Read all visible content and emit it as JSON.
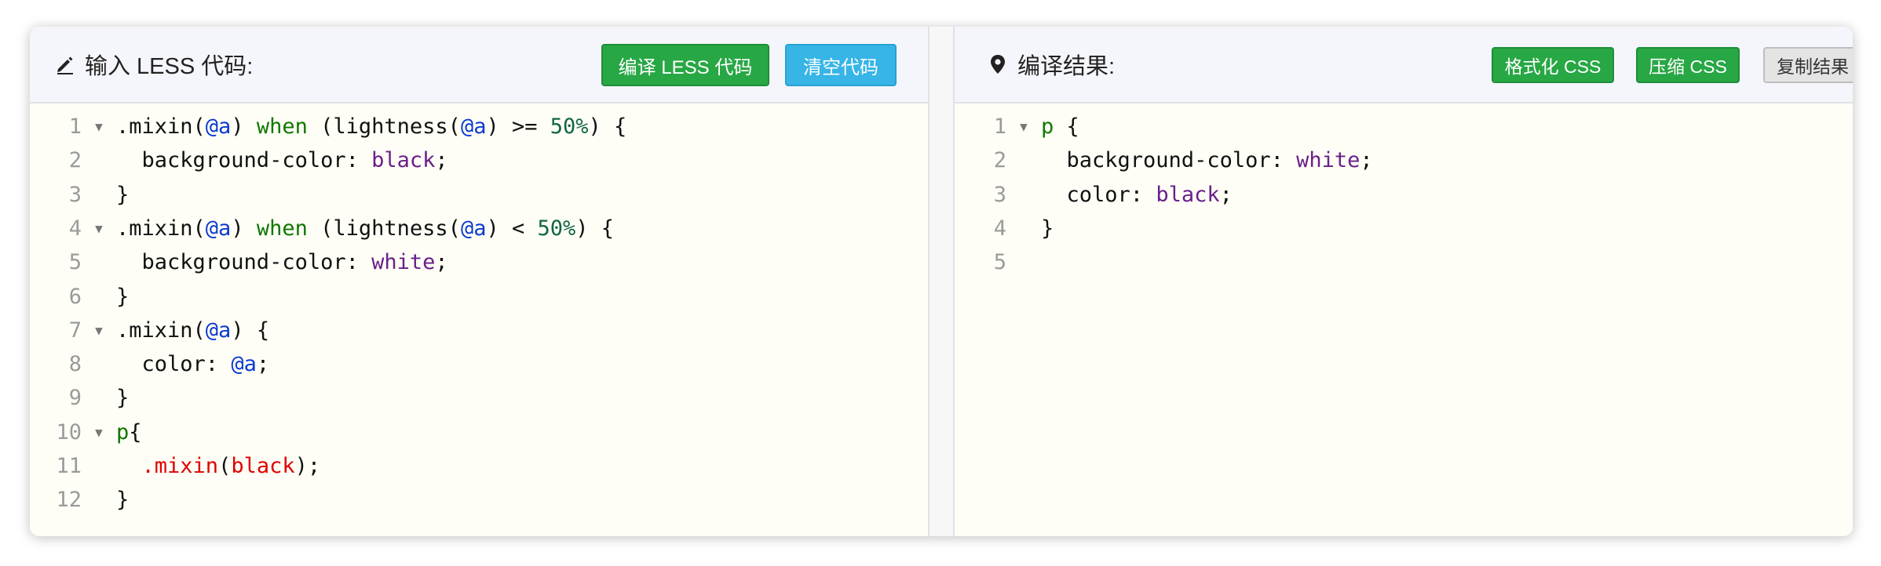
{
  "left": {
    "title": "输入 LESS 代码:",
    "title_icon": "pencil-icon",
    "buttons": {
      "compile": "编译 LESS 代码",
      "clear": "清空代码"
    },
    "code": [
      {
        "n": "1",
        "fold": true,
        "tokens": [
          [
            "def",
            ".mixin("
          ],
          [
            "var",
            "@a"
          ],
          [
            "def",
            ") "
          ],
          [
            "kw",
            "when"
          ],
          [
            "def",
            " (lightness("
          ],
          [
            "var",
            "@a"
          ],
          [
            "def",
            ") >= "
          ],
          [
            "num",
            "50%"
          ],
          [
            "def",
            ") {"
          ]
        ]
      },
      {
        "n": "2",
        "fold": false,
        "tokens": [
          [
            "def",
            "  background-color: "
          ],
          [
            "atom",
            "black"
          ],
          [
            "def",
            ";"
          ]
        ]
      },
      {
        "n": "3",
        "fold": false,
        "tokens": [
          [
            "def",
            "}"
          ]
        ]
      },
      {
        "n": "4",
        "fold": true,
        "tokens": [
          [
            "def",
            ".mixin("
          ],
          [
            "var",
            "@a"
          ],
          [
            "def",
            ") "
          ],
          [
            "kw",
            "when"
          ],
          [
            "def",
            " (lightness("
          ],
          [
            "var",
            "@a"
          ],
          [
            "def",
            ") < "
          ],
          [
            "num",
            "50%"
          ],
          [
            "def",
            ") {"
          ]
        ]
      },
      {
        "n": "5",
        "fold": false,
        "tokens": [
          [
            "def",
            "  background-color: "
          ],
          [
            "atom",
            "white"
          ],
          [
            "def",
            ";"
          ]
        ]
      },
      {
        "n": "6",
        "fold": false,
        "tokens": [
          [
            "def",
            "}"
          ]
        ]
      },
      {
        "n": "7",
        "fold": true,
        "tokens": [
          [
            "def",
            ".mixin("
          ],
          [
            "var",
            "@a"
          ],
          [
            "def",
            ") {"
          ]
        ]
      },
      {
        "n": "8",
        "fold": false,
        "tokens": [
          [
            "def",
            "  color: "
          ],
          [
            "var",
            "@a"
          ],
          [
            "def",
            ";"
          ]
        ]
      },
      {
        "n": "9",
        "fold": false,
        "tokens": [
          [
            "def",
            "}"
          ]
        ]
      },
      {
        "n": "10",
        "fold": true,
        "tokens": [
          [
            "tag",
            "p"
          ],
          [
            "def",
            "{"
          ]
        ]
      },
      {
        "n": "11",
        "fold": false,
        "tokens": [
          [
            "def",
            "  "
          ],
          [
            "err",
            ".mixin"
          ],
          [
            "def",
            "("
          ],
          [
            "err",
            "black"
          ],
          [
            "def",
            ");"
          ]
        ]
      },
      {
        "n": "12",
        "fold": false,
        "tokens": [
          [
            "def",
            "}"
          ]
        ]
      }
    ]
  },
  "right": {
    "title": "编译结果:",
    "title_icon": "map-pin-icon",
    "buttons": {
      "format": "格式化 CSS",
      "minify": "压缩 CSS",
      "copy": "复制结果"
    },
    "code": [
      {
        "n": "1",
        "fold": true,
        "tokens": [
          [
            "tag",
            "p"
          ],
          [
            "def",
            " {"
          ]
        ]
      },
      {
        "n": "2",
        "fold": false,
        "tokens": [
          [
            "def",
            "  background-color: "
          ],
          [
            "atom",
            "white"
          ],
          [
            "def",
            ";"
          ]
        ]
      },
      {
        "n": "3",
        "fold": false,
        "tokens": [
          [
            "def",
            "  color: "
          ],
          [
            "atom",
            "black"
          ],
          [
            "def",
            ";"
          ]
        ]
      },
      {
        "n": "4",
        "fold": false,
        "tokens": [
          [
            "def",
            "}"
          ]
        ]
      },
      {
        "n": "5",
        "fold": false,
        "tokens": []
      }
    ]
  },
  "colors": {
    "green_button": "#28a745",
    "blue_button": "#36b5e6",
    "editor_bg": "#fefef6"
  }
}
